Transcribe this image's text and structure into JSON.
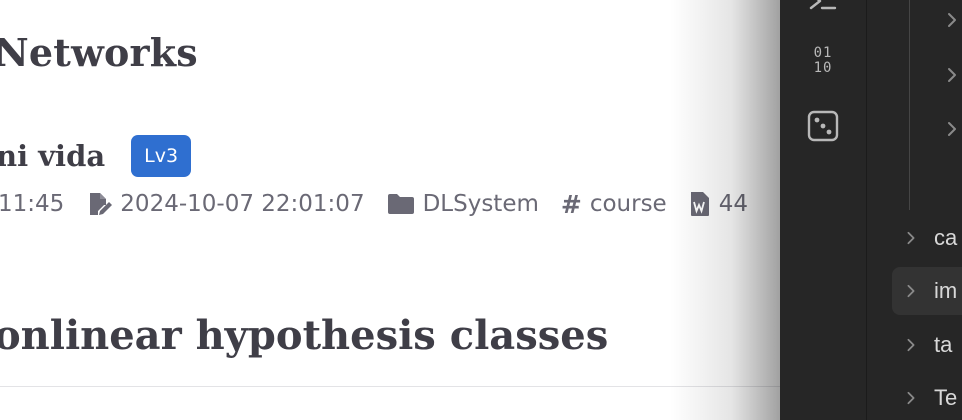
{
  "article": {
    "title": "Networks",
    "author": "ni vida",
    "level_badge": "Lv3",
    "meta": {
      "created_time": "11:45",
      "updated": "2024-10-07 22:01:07",
      "category": "DLSystem",
      "tag": "course",
      "word_count": "44"
    },
    "section_heading": "onlinear hypothesis classes"
  },
  "sidebar": {
    "activity_icons": [
      "terminal-icon",
      "binary-icon",
      "dice-icon"
    ],
    "binary_glyph_top": "01",
    "binary_glyph_bottom": "10",
    "nested_chevron_count": 3,
    "folders": [
      {
        "label": "ca",
        "selected": false
      },
      {
        "label": "im",
        "selected": true
      },
      {
        "label": "ta",
        "selected": false
      },
      {
        "label": "Te",
        "selected": false
      }
    ]
  },
  "colors": {
    "badge": "#2f6fd0",
    "title_text": "#3f3e47",
    "meta_text": "#6a6975",
    "sidebar_bg": "#262626",
    "selected_row": "#333333"
  }
}
